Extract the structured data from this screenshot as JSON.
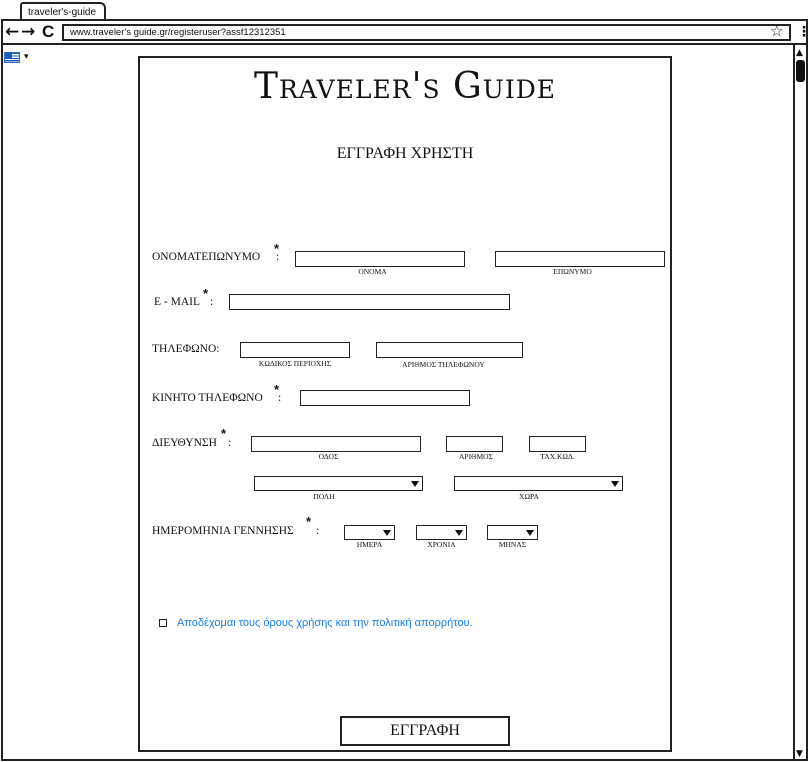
{
  "browser": {
    "tab_title": "traveler's-guide",
    "back_icon": "←",
    "forward_icon": "→",
    "reload_icon": "C",
    "url": "www.traveler's guide.gr/registeruser?assf12312351",
    "bookmark_icon": "☆",
    "menu_icon": "⋮"
  },
  "language": {
    "flag": "greek-flag-icon",
    "caret": "▾"
  },
  "scrollbar": {
    "up": "▲",
    "down": "▼"
  },
  "page": {
    "logo": "Traveler's Guide",
    "title": "ΕΓΓΡΑΦΗ ΧΡΗΣΤΗ"
  },
  "form": {
    "required_mark": "*",
    "fullname": {
      "label": "ΟΝΟΜΑΤΕΠΩΝΥΜΟ",
      "colon": ":",
      "first_hint": "ΟΝΟΜΑ",
      "last_hint": "ΕΠΩΝΥΜΟ",
      "first_value": "",
      "last_value": ""
    },
    "email": {
      "label": "Ε - MAIL",
      "colon": ":",
      "value": ""
    },
    "phone": {
      "label": "ΤΗΛΕΦΩΝΟ:",
      "area_hint": "ΚΩΔΙΚΟΣ ΠΕΡΙΟΧΗΣ",
      "number_hint": "ΑΡΙΘΜΟΣ ΤΗΛΕΦΩΝΟΥ"
    },
    "mobile": {
      "label": "ΚΙΝΗΤΟ ΤΗΛΕΦΩΝΟ",
      "colon": ":",
      "value": ""
    },
    "address": {
      "label": "ΔΙΕΥΘΥΝΣΗ",
      "colon": ":",
      "street_hint": "ΟΔΟΣ",
      "number_hint": "ΑΡΙΘΜΟΣ",
      "zip_hint": "ΤΑΧ.ΚΩΔ.",
      "city_hint": "ΠΟΛΗ",
      "country_hint": "ΧΩΡΑ"
    },
    "birthdate": {
      "label": "ΗΜΕΡΟΜΗΝΙΑ ΓΕΝΝΗΣΗΣ",
      "colon": ":",
      "day_hint": "ΗΜΕΡΑ",
      "year_hint": "ΧΡΟΝΙΑ",
      "month_hint": "ΜΗΝΑΣ"
    },
    "terms_text": "Αποδέχομαι τους όρους χρήσης και την πολιτική απορρήτου.",
    "terms_checked": false,
    "submit_label": "ΕΓΓΡΑΦΗ"
  },
  "colors": {
    "link": "#1a7fe0",
    "ink": "#222222",
    "flag_blue": "#1a5fb4"
  }
}
